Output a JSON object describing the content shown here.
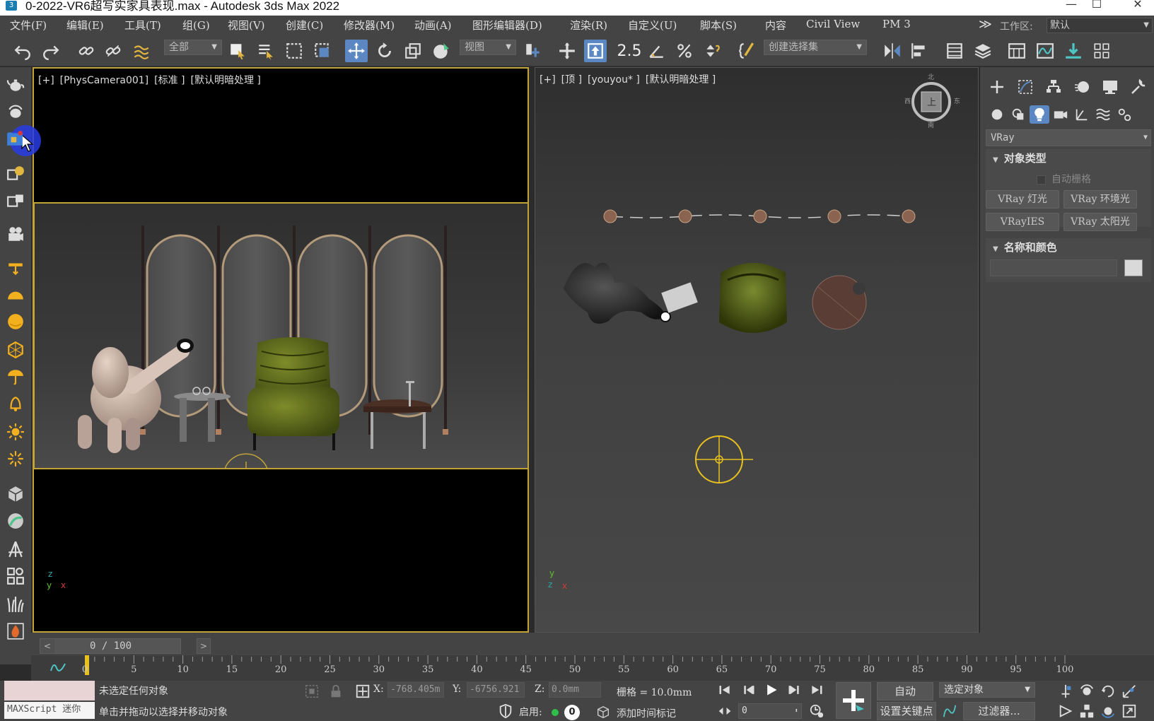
{
  "window": {
    "title": "0-2022-VR6超写实家具表现.max - Autodesk 3ds Max 2022",
    "min_glyph": "—",
    "max_glyph": "☐",
    "close_glyph": "✕"
  },
  "menu": {
    "items": [
      "文件(F)",
      "编辑(E)",
      "工具(T)",
      "组(G)",
      "视图(V)",
      "创建(C)",
      "修改器(M)",
      "动画(A)",
      "图形编辑器(D)",
      "渲染(R)",
      "自定义(U)",
      "脚本(S)",
      "内容",
      "Civil View",
      "PM 3"
    ],
    "overflow_glyph": "≫",
    "workspace_label": "工作区:",
    "workspace_value": "默认"
  },
  "toolbar": {
    "selection_filter": "全部",
    "reference_coord": "视图",
    "selection_set_placeholder": "创建选择集",
    "snap_toggle_label": "2.5"
  },
  "viewports": {
    "camera": {
      "label_plus": "[+]",
      "label_view": "[PhysCamera001]",
      "label_mode": "[标准 ]",
      "label_shading": "[默认明暗处理 ]",
      "axis_x": "x",
      "axis_y": "y",
      "axis_z": "z"
    },
    "top": {
      "label_plus": "[+]",
      "label_view": "[顶 ]",
      "label_mode": "[youyou* ]",
      "label_shading": "[默认明暗处理 ]",
      "axis_x": "x",
      "axis_y": "y",
      "axis_z": "z",
      "viewcube_face": "上",
      "compass_n": "北",
      "compass_s": "南",
      "compass_w": "西",
      "compass_e": "东"
    }
  },
  "command_panel": {
    "renderer_dropdown": "VRay",
    "object_type_title": "对象类型",
    "autogrid_label": "自动栅格",
    "buttons": [
      "VRay 灯光",
      "VRay 环境光",
      "VRayIES",
      "VRay 太阳光"
    ],
    "name_color_title": "名称和颜色",
    "name_value": "",
    "swatch_color": "#d9d9d9"
  },
  "time_slider": {
    "frame_display": "0 / 100",
    "prev_glyph": "<",
    "next_glyph": ">"
  },
  "trackbar": {
    "ticks": [
      "0",
      "5",
      "10",
      "15",
      "20",
      "25",
      "30",
      "35",
      "40",
      "45",
      "50",
      "55",
      "60",
      "65",
      "70",
      "75",
      "80",
      "85",
      "90",
      "95",
      "100"
    ]
  },
  "status": {
    "maxscript_label": "MAXScript 迷你",
    "selection_status": "未选定任何对象",
    "prompt": "单击并拖动以选择并移动对象",
    "x_label": "X:",
    "x_value": "-768.405m",
    "y_label": "Y:",
    "y_value": "-6756.921",
    "z_label": "Z:",
    "z_value": "0.0mm",
    "grid_label": "栅格 = 10.0mm",
    "enable_label": "启用:",
    "enable_value": "0",
    "add_time_tag": "添加时间标记",
    "auto_key": "自动",
    "set_key": "设置关键点",
    "selected_object": "选定对象",
    "filters": "过滤器...",
    "current_frame": "0"
  },
  "colors": {
    "accent_blue": "#5b87c2",
    "active_viewport_border": "#c2a33a",
    "key_red": "#e8d4d4"
  },
  "icons": {
    "leftbar": [
      "teapot-icon",
      "light-bulb-icon",
      "render-frame-icon",
      "paint-icon",
      "camera-stack-icon",
      "camera-icon",
      "spotlight-icon",
      "dome-light-icon",
      "sphere-light-icon",
      "geosphere-icon",
      "umbrella-icon",
      "bell-icon",
      "sun-icon",
      "burst-icon",
      "cube-icon",
      "sphere-render-icon",
      "tripod-icon",
      "grid-objects-icon",
      "grass-icon",
      "fire-icon"
    ]
  }
}
